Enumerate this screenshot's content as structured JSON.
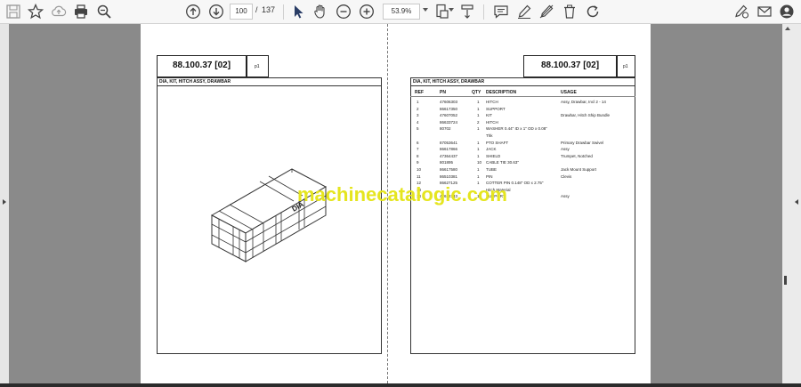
{
  "toolbar": {
    "page_current": "100",
    "page_separator": "/",
    "page_total": "137",
    "zoom": "53.9%"
  },
  "left_page": {
    "part_number": "88.100.37 [02]",
    "sheet": "p1",
    "title": "DIA, KIT, HITCH ASSY, DRAWBAR",
    "crate_label": "DIA"
  },
  "right_page": {
    "part_number": "88.100.37 [02]",
    "sheet": "p1",
    "title": "DIA, KIT, HITCH ASSY, DRAWBAR",
    "columns": [
      "REF",
      "PN",
      "QTY",
      "DESCRIPTION",
      "USAGE"
    ],
    "rows": [
      {
        "ref": "1",
        "pn": "47606303",
        "qty": "1",
        "desc": "HITCH",
        "usage": "Assy, Drawbar, Incl 2 - 14"
      },
      {
        "ref": "2",
        "pn": "86617350",
        "qty": "1",
        "desc": "SUPPORT",
        "usage": ""
      },
      {
        "ref": "3",
        "pn": "47607052",
        "qty": "1",
        "desc": "KIT",
        "usage": "Drawbar, Hitch Ship Bundle"
      },
      {
        "ref": "4",
        "pn": "86633724",
        "qty": "2",
        "desc": "HITCH",
        "usage": ""
      },
      {
        "ref": "5",
        "pn": "80702",
        "qty": "1",
        "desc": "WASHER 0.44\" ID x 1\" OD x 0.08\"",
        "usage": ""
      },
      {
        "ref": "",
        "pn": "",
        "qty": "",
        "desc": "Thk",
        "usage": ""
      },
      {
        "ref": "6",
        "pn": "87053641",
        "qty": "1",
        "desc": "PTO SHAFT",
        "usage": "Primary Drawbar Swivel"
      },
      {
        "ref": "7",
        "pn": "86617866",
        "qty": "1",
        "desc": "JACK",
        "usage": "Assy"
      },
      {
        "ref": "8",
        "pn": "47364437",
        "qty": "1",
        "desc": "SHIELD",
        "usage": "Trumpet, Notched"
      },
      {
        "ref": "9",
        "pn": "801895",
        "qty": "10",
        "desc": "CABLE TIE 30.63\"",
        "usage": ""
      },
      {
        "ref": "10",
        "pn": "86617580",
        "qty": "1",
        "desc": "TUBE",
        "usage": "Jack Mount Support"
      },
      {
        "ref": "11",
        "pn": "86510381",
        "qty": "1",
        "desc": "PIN",
        "usage": "Clevis"
      },
      {
        "ref": "12",
        "pn": "86627125",
        "qty": "1",
        "desc": "COTTER PIN 0.148\" OD x 2.75\"",
        "usage": ""
      },
      {
        "ref": "13",
        "pn": "",
        "qty": "",
        "desc": "Hitch Material",
        "usage": ""
      },
      {
        "ref": "14",
        "pn": "47612343",
        "qty": "1",
        "desc": "SUPPORT",
        "usage": "Assy"
      }
    ]
  },
  "watermark": "machinecatalogic.com"
}
